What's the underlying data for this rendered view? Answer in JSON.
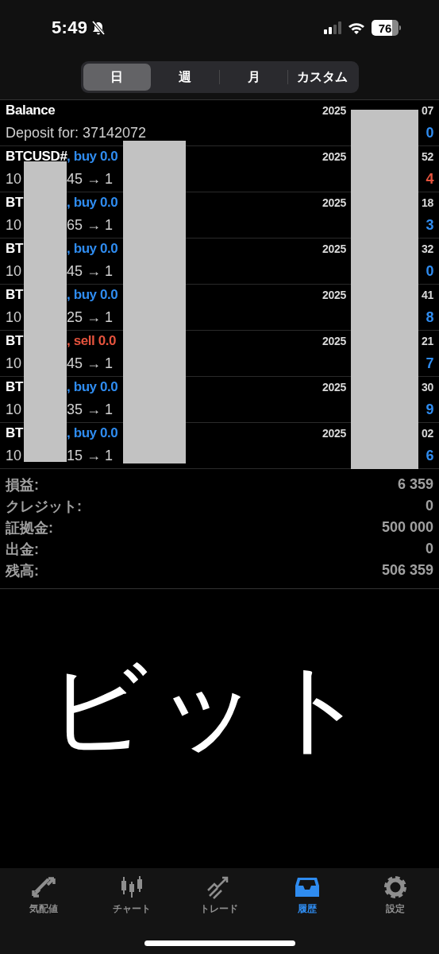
{
  "status_bar": {
    "time": "5:49",
    "battery": "76"
  },
  "periods": [
    {
      "label": "日",
      "selected": true
    },
    {
      "label": "週",
      "selected": false
    },
    {
      "label": "月",
      "selected": false
    },
    {
      "label": "カスタム",
      "selected": false
    }
  ],
  "deals": [
    {
      "kind": "balance",
      "title": "Balance",
      "comment": "Deposit for: 37142072",
      "time": [
        "2025",
        "07"
      ],
      "profit": "0",
      "loss": false
    },
    {
      "kind": "buy",
      "symbol": "BTCUSD#",
      "deal": ", buy 0.0",
      "prices": [
        "10",
        "45 → 1"
      ],
      "time": [
        "2025",
        "52"
      ],
      "profit": "4",
      "loss": true
    },
    {
      "kind": "buy",
      "symbol": "BT",
      "deal": ", buy 0.0",
      "prices": [
        "10",
        "65 → 1"
      ],
      "time": [
        "2025",
        "18"
      ],
      "profit": "3",
      "loss": false
    },
    {
      "kind": "buy",
      "symbol": "BT",
      "deal": ", buy 0.0",
      "prices": [
        "10",
        "45 → 1"
      ],
      "time": [
        "2025",
        "32"
      ],
      "profit": "0",
      "loss": false
    },
    {
      "kind": "buy",
      "symbol": "BT",
      "deal": ", buy 0.0",
      "prices": [
        "10",
        "25 → 1"
      ],
      "time": [
        "2025",
        "41"
      ],
      "profit": "8",
      "loss": false
    },
    {
      "kind": "sell",
      "symbol": "BT",
      "deal": ", sell 0.0",
      "prices": [
        "10",
        "45 → 1"
      ],
      "time": [
        "2025",
        "21"
      ],
      "profit": "7",
      "loss": false
    },
    {
      "kind": "buy",
      "symbol": "BT",
      "deal": ", buy 0.0",
      "prices": [
        "10",
        "35 → 1"
      ],
      "time": [
        "2025",
        "30"
      ],
      "profit": "9",
      "loss": false
    },
    {
      "kind": "buy",
      "symbol": "BT",
      "deal": ", buy 0.0",
      "prices": [
        "10",
        "15 → 1"
      ],
      "time": [
        "2025",
        "02"
      ],
      "profit": "6",
      "loss": false
    }
  ],
  "summary": [
    {
      "label": "損益:",
      "value": "6 359"
    },
    {
      "label": "クレジット:",
      "value": "0"
    },
    {
      "label": "証拠金:",
      "value": "500 000"
    },
    {
      "label": "出金:",
      "value": "0"
    },
    {
      "label": "残高:",
      "value": "506 359"
    }
  ],
  "handwritten_note": "ビット",
  "tab_bar": [
    {
      "kind": "quotes",
      "label": "気配値",
      "selected": false
    },
    {
      "kind": "chart",
      "label": "チャート",
      "selected": false
    },
    {
      "kind": "trade",
      "label": "トレード",
      "selected": false
    },
    {
      "kind": "history",
      "label": "履歴",
      "selected": true
    },
    {
      "kind": "settings",
      "label": "設定",
      "selected": false
    }
  ]
}
